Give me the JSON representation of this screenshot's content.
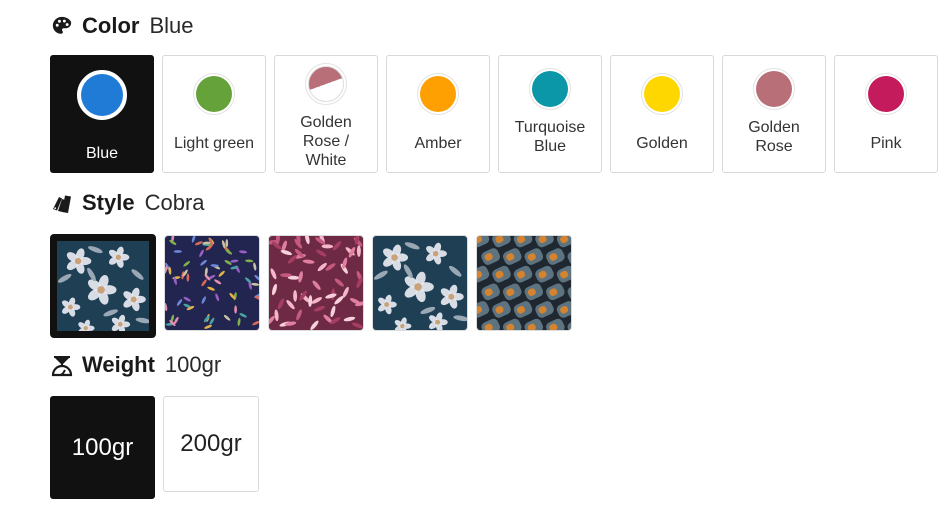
{
  "color": {
    "label": "Color",
    "selected": "Blue",
    "options": [
      {
        "label": "Blue",
        "hex": "#1f7bd6",
        "selected": true
      },
      {
        "label": "Light green",
        "hex": "#66a23a",
        "selected": false
      },
      {
        "label": "Golden\nRose /\nWhite",
        "hex": "#b96f78",
        "hex2": "#ffffff",
        "selected": false
      },
      {
        "label": "Amber",
        "hex": "#fe9f02",
        "selected": false
      },
      {
        "label": "Turquoise\nBlue",
        "hex": "#0c97a8",
        "selected": false
      },
      {
        "label": "Golden",
        "hex": "#fed700",
        "selected": false
      },
      {
        "label": "Golden\nRose",
        "hex": "#b96f78",
        "selected": false
      },
      {
        "label": "Pink",
        "hex": "#c41b5c",
        "selected": false
      }
    ]
  },
  "style": {
    "label": "Style",
    "selected": "Cobra",
    "options": [
      {
        "pattern": "navy-floral",
        "selected": true
      },
      {
        "pattern": "confetti-leaves",
        "selected": false
      },
      {
        "pattern": "pink-petals",
        "selected": false
      },
      {
        "pattern": "navy-floral",
        "selected": false
      },
      {
        "pattern": "cobra-scales",
        "selected": false
      }
    ]
  },
  "weight": {
    "label": "Weight",
    "selected": "100gr",
    "options": [
      {
        "label": "100gr",
        "selected": true
      },
      {
        "label": "200gr",
        "selected": false
      }
    ]
  },
  "icons": {
    "color": "palette-icon",
    "style": "swatch-book-icon",
    "weight": "scale-icon"
  }
}
